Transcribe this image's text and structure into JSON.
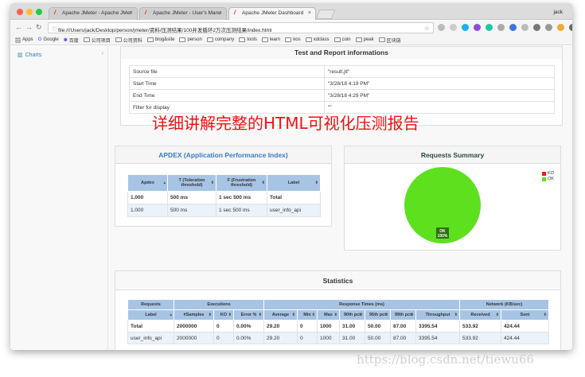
{
  "browser": {
    "profile": "jack",
    "tabs": [
      {
        "label": "Apache JMeter - Apache JMet",
        "active": false
      },
      {
        "label": "Apache JMeter - User's Manu",
        "active": false
      },
      {
        "label": "Apache JMeter Dashboard",
        "active": true
      }
    ],
    "url": "file:///Users/jack/Desktop/person/jmeter/资料/压测结果/100并发循环2万次压测结果/index.html",
    "bookmarks": [
      "Apps",
      "Google",
      "百度",
      "公司项目",
      "公司资料",
      "blog&site",
      "person",
      "company",
      "tools",
      "learn",
      "kos",
      "xdclass",
      "coin",
      "peak",
      "区块链"
    ]
  },
  "sidebar": {
    "charts_label": "Charts",
    "collapse_icon": "‹"
  },
  "test_info": {
    "title": "Test and Report informations",
    "rows": [
      {
        "label": "Source file",
        "value": "\"result.jtl\""
      },
      {
        "label": "Start Time",
        "value": "\"3/28/18 4:19 PM\""
      },
      {
        "label": "End Time",
        "value": "\"3/28/18 4:29 PM\""
      },
      {
        "label": "Filter for display",
        "value": "\"\""
      }
    ]
  },
  "overlay_title": "详细讲解完整的HTML可视化压测报告",
  "apdex": {
    "title": "APDEX (Application Performance Index)",
    "headers": [
      "Apdex",
      "T (Toleration threshold)",
      "F (Frustration threshold)",
      "Label"
    ],
    "rows": [
      [
        "1.000",
        "500 ms",
        "1 sec 500 ms",
        "Total"
      ],
      [
        "1.000",
        "500 ms",
        "1 sec 500 ms",
        "user_info_api"
      ]
    ]
  },
  "requests_summary": {
    "title": "Requests Summary",
    "legend": [
      {
        "label": "KO",
        "color": "#ee1c1c"
      },
      {
        "label": "OK",
        "color": "#5de11f"
      }
    ],
    "pie_label": "OK",
    "pie_percent": "100%"
  },
  "chart_data": {
    "type": "pie",
    "title": "Requests Summary",
    "categories": [
      "KO",
      "OK"
    ],
    "values": [
      0,
      100
    ]
  },
  "statistics": {
    "title": "Statistics",
    "group_headers": [
      "Requests",
      "Executions",
      "Response Times (ms)",
      "Network (KB/sec)"
    ],
    "headers": [
      "Label",
      "#Samples",
      "KO",
      "Error %",
      "Average",
      "Min",
      "Max",
      "90th pct",
      "95th pct",
      "99th pct",
      "Throughput",
      "Received",
      "Sent"
    ],
    "rows": [
      [
        "Total",
        "2000000",
        "0",
        "0.00%",
        "29.20",
        "0",
        "1000",
        "31.00",
        "50.00",
        "87.00",
        "3395.54",
        "533.92",
        "424.44"
      ],
      [
        "user_info_api",
        "2000000",
        "0",
        "0.00%",
        "29.20",
        "0",
        "1000",
        "31.00",
        "50.00",
        "87.00",
        "3395.54",
        "533.92",
        "424.44"
      ]
    ]
  },
  "watermark": "https://blog.csdn.net/tiewu66"
}
